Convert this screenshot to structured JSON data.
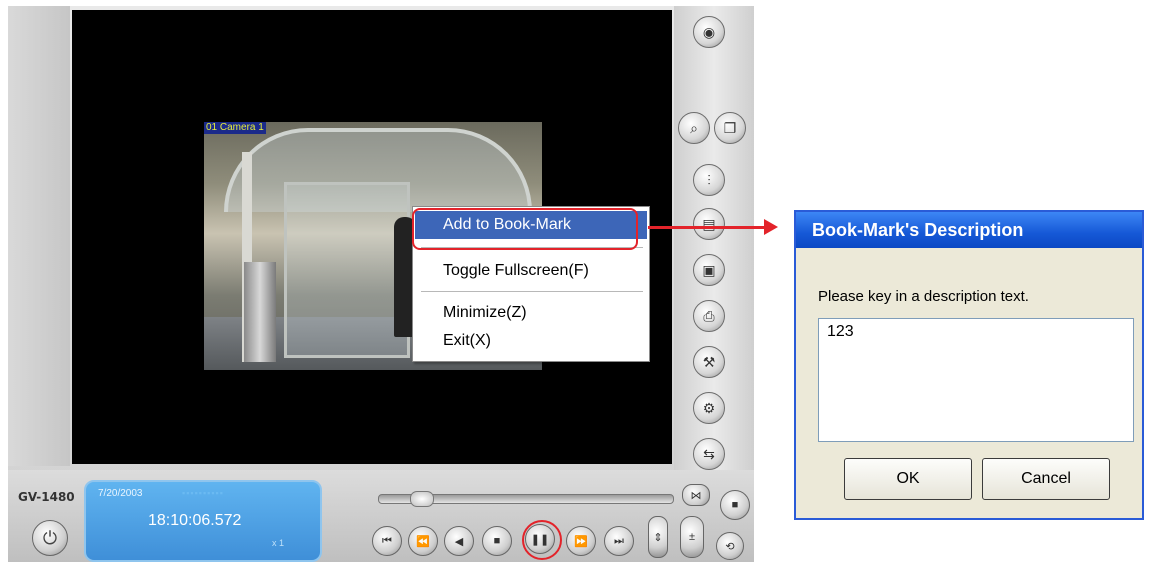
{
  "player": {
    "camera_label": "01 Camera 1",
    "model": "GV-1480",
    "lcd": {
      "date": "7/20/2003",
      "time": "18:10:06.572",
      "speed": "x 1"
    }
  },
  "context_menu": {
    "items": [
      {
        "label": "Add to Book-Mark",
        "highlighted": true
      },
      {
        "label": "Toggle Fullscreen(F)"
      },
      {
        "label": "Minimize(Z)"
      },
      {
        "label": "Exit(X)"
      }
    ]
  },
  "dialog": {
    "title": "Book-Mark's Description",
    "prompt": "Please key in a description text.",
    "text_value": "123",
    "ok_label": "OK",
    "cancel_label": "Cancel"
  },
  "colors": {
    "highlight": "#3d66b8",
    "annotation_red": "#e3232a",
    "titlebar_blue": "#1558d6",
    "lcd_blue": "#4f9fe4"
  },
  "icons": {
    "right_panel": [
      "camera-settings-icon",
      "search-icon",
      "copy-icon",
      "equalizer-icon",
      "save-icon",
      "floppy-icon",
      "print-icon",
      "tools-icon",
      "gear-icon",
      "export-icon"
    ],
    "playback": [
      "first-icon",
      "prev-frame-icon",
      "rewind-icon",
      "stop-icon",
      "pause-icon",
      "next-frame-icon",
      "last-icon"
    ]
  }
}
